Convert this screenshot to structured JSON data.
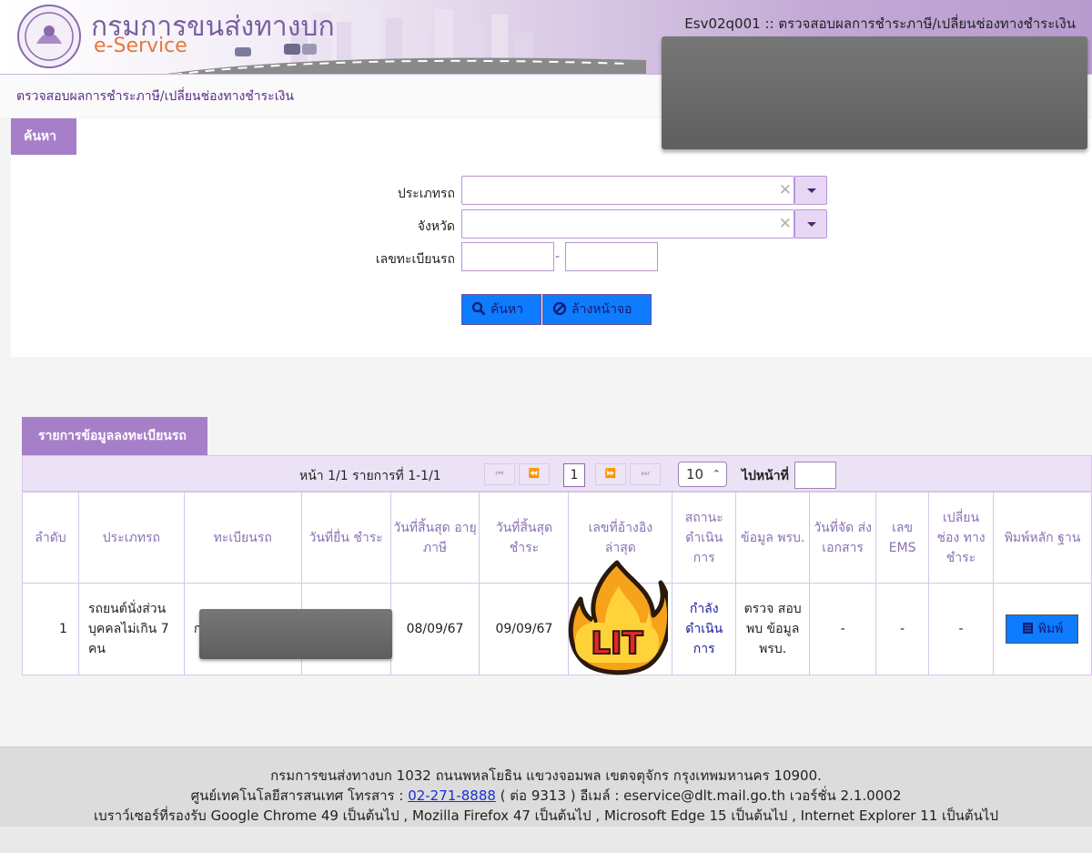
{
  "header": {
    "logo_th": "กรมการขนส่งทางบก",
    "logo_en": "e-Service",
    "screen_code": "Esv02q001 :: ตรวจสอบผลการชำระภาษี/เปลี่ยนช่องทางชำระเงิน"
  },
  "breadcrumb": "ตรวจสอบผลการชำระภาษี/เปลี่ยนช่องทางชำระเงิน",
  "search": {
    "tab_label": "ค้นหา",
    "vehicle_type_label": "ประเภทรถ",
    "vehicle_type_value": "",
    "province_label": "จังหวัด",
    "province_value": "",
    "plate_label": "เลขทะเบียนรถ",
    "plate_part1": "",
    "plate_separator": "-",
    "plate_part2": "",
    "clear_glyph": "✕",
    "search_button": "ค้นหา",
    "reset_button": "ล้างหน้าจอ"
  },
  "results": {
    "tab_label": "รายการข้อมูลลงทะเบียนรถ",
    "pager": {
      "info": "หน้า 1/1 รายการที่ 1-1/1",
      "first": "⏮",
      "prev": "⏪",
      "current_page": "1",
      "next": "⏩",
      "last": "⏭",
      "page_size": "10",
      "page_size_arrow": "⌃",
      "goto_label": "ไปหน้าที่",
      "goto_value": ""
    },
    "columns": [
      "ลำดับ",
      "ประเภทรถ",
      "ทะเบียนรถ",
      "วันที่ยื่น ชำระ",
      "วันที่สิ้นสุด อายุภาษี",
      "วันที่สิ้นสุด ชำระ",
      "เลขที่อ้างอิง ล่าสุด",
      "สถานะ ดำเนิน การ",
      "ข้อมูล พรบ.",
      "วันที่จัด ส่ง เอกสาร",
      "เลข EMS",
      "เปลี่ยน ช่อง ทาง ชำระ",
      "พิมพ์หลัก ฐาน"
    ],
    "rows": [
      {
        "no": "1",
        "vehicle_type": "รถยนต์นั่งส่วนบุคคลไม่เกิน 7 คน",
        "plate": "ก",
        "submit_date": "",
        "tax_expiry": "08/09/67",
        "payment_expiry": "09/09/67",
        "reference_no": "",
        "status": "กำลัง ดำเนิน การ",
        "insurance_info": "ตรวจ สอบพบ ข้อมูล พรบ.",
        "delivery_date": "-",
        "ems_no": "-",
        "change_channel": "-",
        "print_label": "พิมพ์"
      }
    ]
  },
  "sticker_text": "LIT",
  "footer": {
    "line1": "กรมการขนส่งทางบก 1032 ถนนพหลโยธิน แขวงจอมพล เขตจตุจักร กรุงเทพมหานคร 10900.",
    "line2_prefix": "ศูนย์เทคโนโลยีสารสนเทศ โทรสาร : ",
    "phone": "02-271-8888",
    "line2_suffix": " ( ต่อ 9313 ) อีเมล์ : eservice@dlt.mail.go.th เวอร์ชั่น 2.1.0002",
    "line3": "เบราว์เซอร์ที่รองรับ Google Chrome 49 เป็นต้นไป , Mozilla Firefox 47 เป็นต้นไป , Microsoft Edge 15 เป็นต้นไป , Internet Explorer 11 เป็นต้นไป"
  },
  "colors": {
    "accent_purple": "#a77fc9",
    "button_blue": "#0d7cff",
    "status_text": "#1a1aa0"
  }
}
